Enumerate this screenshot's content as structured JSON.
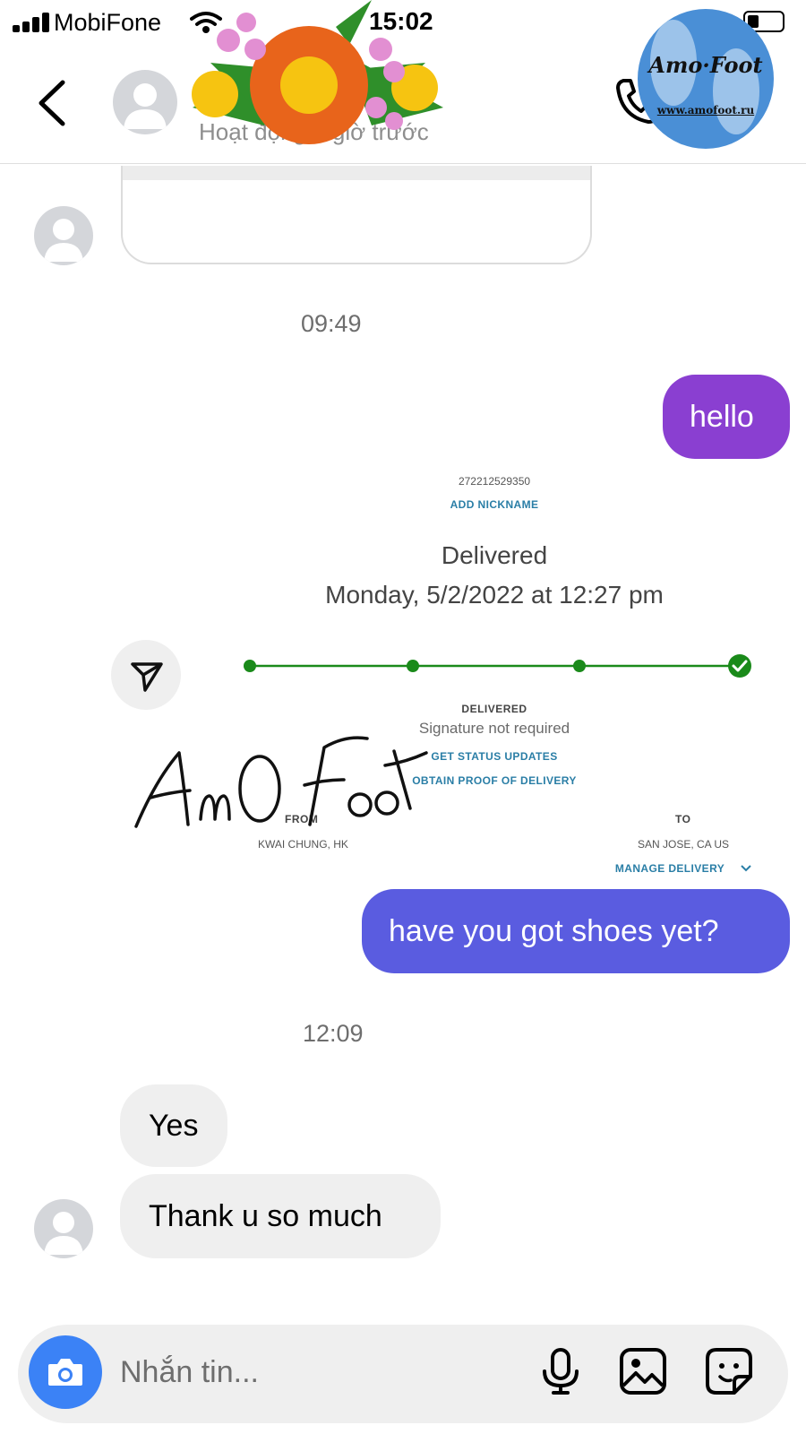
{
  "status_bar": {
    "carrier": "MobiFone",
    "time": "15:02"
  },
  "header": {
    "name": "",
    "subtitle": "Hoạt động 1 giờ trước"
  },
  "thread": {
    "timestamp_1": "09:49",
    "timestamp_2": "12:09",
    "messages": [
      {
        "direction": "outgoing",
        "text": "hello"
      },
      {
        "direction": "outgoing",
        "text": "have you got shoes yet?"
      },
      {
        "direction": "incoming",
        "text": "Yes"
      },
      {
        "direction": "incoming",
        "text": "Thank u so much"
      }
    ]
  },
  "tracking": {
    "tracking_number": "272212529350",
    "add_nickname": "ADD NICKNAME",
    "status": "Delivered",
    "date": "Monday, 5/2/2022 at 12:27 pm",
    "progress_label": "DELIVERED",
    "signature_note": "Signature not required",
    "get_updates": "GET STATUS UPDATES",
    "proof": "OBTAIN PROOF OF DELIVERY",
    "from_label": "FROM",
    "from_value": "KWAI CHUNG, HK",
    "to_label": "TO",
    "to_value": "SAN JOSE, CA US",
    "manage": "MANAGE DELIVERY",
    "progress_accent": "#1a8a1a"
  },
  "composer": {
    "placeholder": "Nhắn tin..."
  },
  "watermark": {
    "logo_text": "Amo·Foot",
    "logo_url": "www.amofoot.ru",
    "signature_text": "AmO Foot"
  },
  "colors": {
    "bubble_hello": "#8a3fd1",
    "bubble_shoes": "#5a5ce0",
    "camera": "#3b82f6",
    "incoming_bg": "#efefef"
  },
  "icons": {
    "back": "chevron-left-icon",
    "call": "phone-icon",
    "share": "send-icon",
    "camera": "camera-icon",
    "mic": "microphone-icon",
    "gallery": "image-icon",
    "sticker": "sticker-icon"
  }
}
